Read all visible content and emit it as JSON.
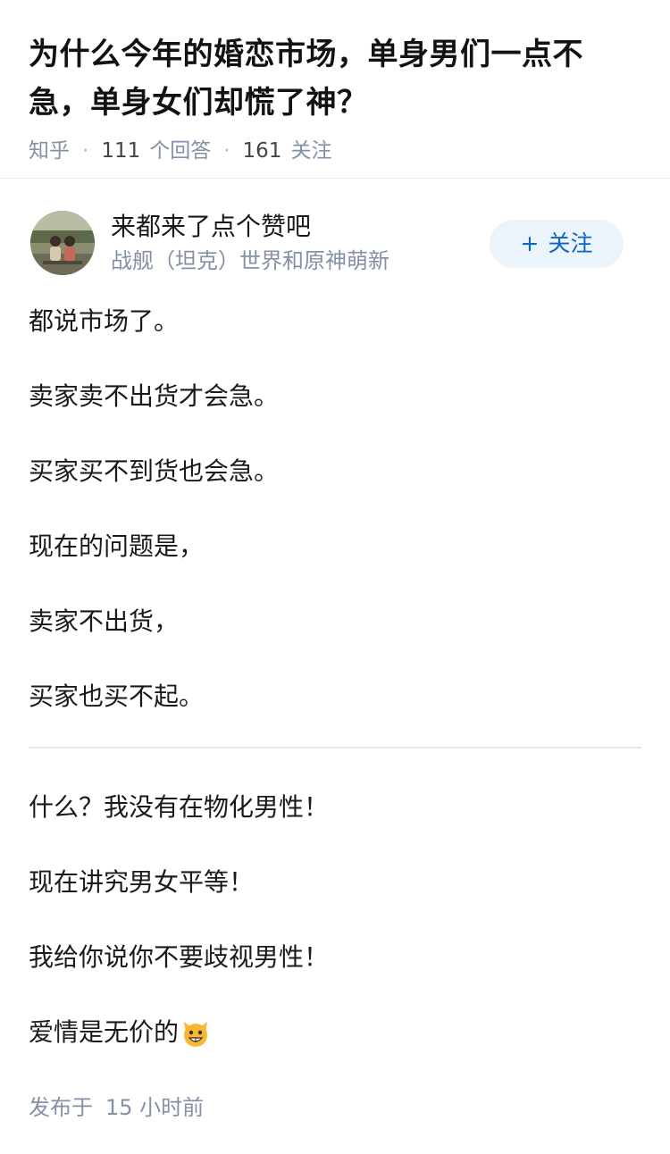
{
  "question": {
    "title": "为什么今年的婚恋市场，单身男们一点不急，单身女们却慌了神？",
    "source": "知乎",
    "answer_count": "111",
    "answer_label": "个回答",
    "follow_count": "161",
    "follow_label": "关注"
  },
  "author": {
    "name": "来都来了点个赞吧",
    "bio": "战舰（坦克）世界和原神萌新",
    "follow_plus": "+",
    "follow_label": "关注"
  },
  "answer": {
    "paragraphs_part1": [
      "都说市场了。",
      "卖家卖不出货才会急。",
      "买家买不到货也会急。",
      "现在的问题是，",
      "卖家不出货，",
      "买家也买不起。"
    ],
    "paragraphs_part2": [
      "什么？我没有在物化男性！",
      "现在讲究男女平等！",
      "我给你说你不要歧视男性！",
      "爱情是无价的"
    ],
    "emoji": "cat-grin-icon"
  },
  "footer": {
    "publish_label": "发布于",
    "publish_time": "15 小时前"
  },
  "colors": {
    "accent": "#0a66c2",
    "follow_bg": "#ebf3fb",
    "meta": "#8590a6",
    "text": "#1a1a1a"
  }
}
